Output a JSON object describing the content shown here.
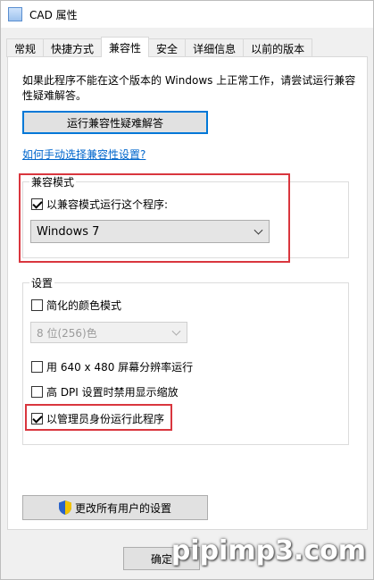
{
  "window": {
    "title": "CAD 属性"
  },
  "tabs": [
    {
      "label": "常规"
    },
    {
      "label": "快捷方式"
    },
    {
      "label": "兼容性"
    },
    {
      "label": "安全"
    },
    {
      "label": "详细信息"
    },
    {
      "label": "以前的版本"
    }
  ],
  "intro_text": "如果此程序不能在这个版本的 Windows 上正常工作，请尝试运行兼容性疑难解答。",
  "troubleshoot_button": "运行兼容性疑难解答",
  "manual_link": "如何手动选择兼容性设置?",
  "compat_group": {
    "title": "兼容模式",
    "checkbox_label": "以兼容模式运行这个程序:",
    "selected_os": "Windows 7"
  },
  "settings_group": {
    "title": "设置",
    "reduced_color_label": "简化的颜色模式",
    "color_select": "8 位(256)色",
    "res_640_label": "用 640 x 480 屏幕分辨率运行",
    "dpi_label": "高 DPI 设置时禁用显示缩放",
    "admin_label": "以管理员身份运行此程序"
  },
  "all_users_button": "更改所有用户的设置",
  "ok_button": "确定",
  "watermark": "pipimp3.com",
  "colors": {
    "highlight": "#d9363e",
    "link": "#0066cc",
    "focus": "#0078d7"
  }
}
